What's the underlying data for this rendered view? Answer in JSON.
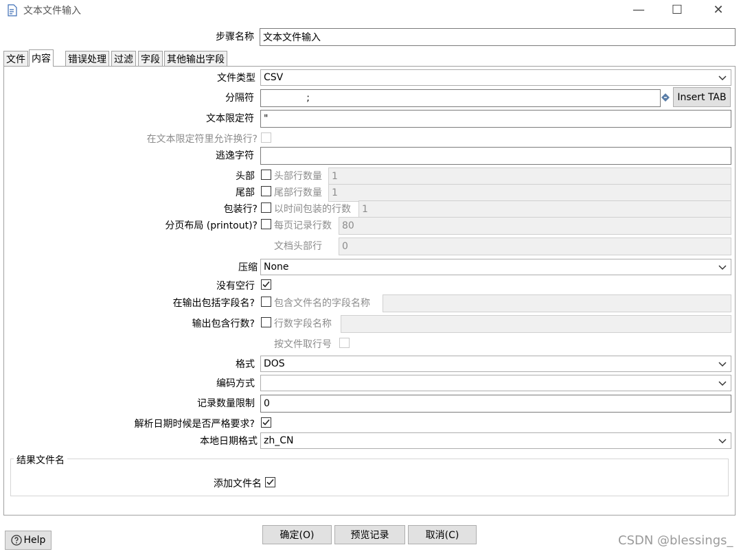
{
  "window": {
    "title": "文本文件输入",
    "minimize_label": "—",
    "maximize_label": "☐",
    "close_label": "✕"
  },
  "step_name": {
    "label": "步骤名称",
    "value": "文本文件输入"
  },
  "tabs": [
    {
      "label": "文件"
    },
    {
      "label": "内容"
    },
    {
      "label": "错误处理"
    },
    {
      "label": "过滤"
    },
    {
      "label": "字段"
    },
    {
      "label": "其他输出字段"
    }
  ],
  "content": {
    "file_type": {
      "label": "文件类型",
      "value": "CSV"
    },
    "separator": {
      "label": "分隔符",
      "value": "              ;",
      "insert_tab_label": "Insert TAB"
    },
    "enclosure": {
      "label": "文本限定符",
      "value": "\""
    },
    "allow_breaks": {
      "label": "在文本限定符里允许换行?"
    },
    "escape": {
      "label": "逃逸字符",
      "value": ""
    },
    "header": {
      "label": "头部",
      "sub_label": "头部行数量",
      "value": "1"
    },
    "footer": {
      "label": "尾部",
      "sub_label": "尾部行数量",
      "value": "1"
    },
    "wrapped": {
      "label": "包装行?",
      "sub_label": "以时间包装的行数",
      "value": "1"
    },
    "paged": {
      "label": "分页布局 (printout)?",
      "sub_label": "每页记录行数",
      "value": "80",
      "doc_header_label": "文档头部行",
      "doc_header_value": "0"
    },
    "compression": {
      "label": "压缩",
      "value": "None"
    },
    "no_empty_rows": {
      "label": "没有空行",
      "checked": true
    },
    "include_filename": {
      "label": "在输出包括字段名?",
      "sub_label": "包含文件名的字段名称",
      "value": ""
    },
    "include_rownum": {
      "label": "输出包含行数?",
      "sub_label": "行数字段名称",
      "value": "",
      "by_file_label": "按文件取行号"
    },
    "format": {
      "label": "格式",
      "value": "DOS"
    },
    "encoding": {
      "label": "编码方式",
      "value": ""
    },
    "limit": {
      "label": "记录数量限制",
      "value": "0"
    },
    "lenient_dates": {
      "label": "解析日期时候是否严格要求?",
      "checked": true
    },
    "locale": {
      "label": "本地日期格式",
      "value": "zh_CN"
    },
    "result_files": {
      "group_label": "结果文件名",
      "add_filename_label": "添加文件名",
      "checked": true
    }
  },
  "footer": {
    "help_label": "Help",
    "ok_label": "确定(O)",
    "preview_label": "预览记录",
    "cancel_label": "取消(C)",
    "watermark": "CSDN @blessings_"
  },
  "colors": {
    "text": "#000000",
    "disabled_text": "#8c8c8c",
    "button_bg": "#e1e1e1",
    "border": "#7a7a7a"
  }
}
